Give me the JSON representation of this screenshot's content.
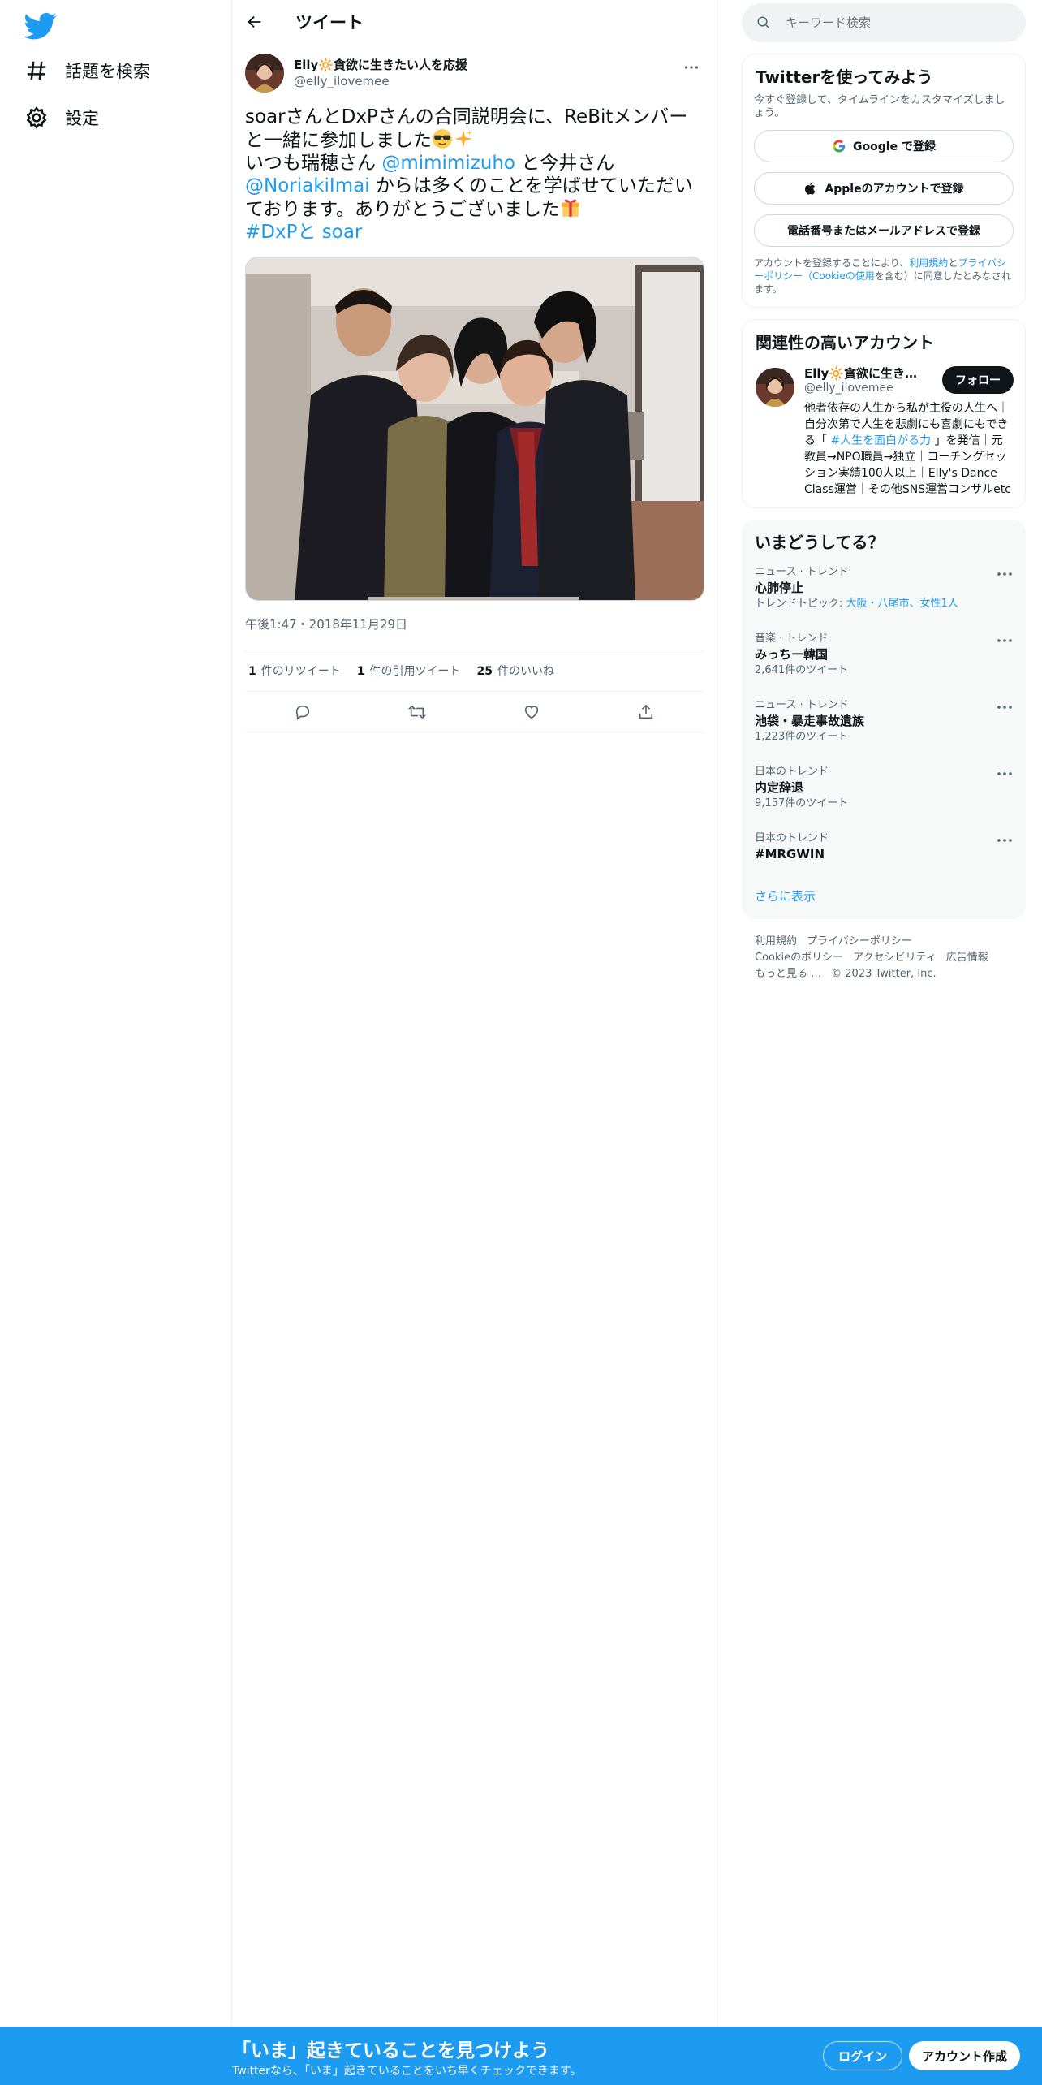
{
  "nav": {
    "items": [
      {
        "label": "話題を検索",
        "icon": "hashtag-icon"
      },
      {
        "label": "設定",
        "icon": "gear-icon"
      }
    ]
  },
  "header": {
    "title": "ツイート"
  },
  "tweet": {
    "author_name": "Elly🔆貪欲に生きたい人を応援",
    "author_handle": "@elly_ilovemee",
    "text": {
      "line1": "soarさんとDxPさんの合同説明会に、ReBitメンバーと一緒に参加しました",
      "line2_pre": "いつも瑞穂さん ",
      "mention1": "@mimimizuho",
      "line2_post": " と今井さん",
      "mention2": "@NoriakiImai",
      "line3_post": " からは多くのことを学ばせていただいております。ありがとうございました",
      "hashtag": "#DxPと soar"
    },
    "timestamp": "午後1:47・2018年11月29日",
    "stats": {
      "retweets_count": "1",
      "retweets_label": "件のリツイート",
      "quotes_count": "1",
      "quotes_label": "件の引用ツイート",
      "likes_count": "25",
      "likes_label": "件のいいね"
    }
  },
  "search": {
    "placeholder": "キーワード検索"
  },
  "signup": {
    "title": "Twitterを使ってみよう",
    "subtitle": "今すぐ登録して、タイムラインをカスタマイズしましょう。",
    "google_label": "Google で登録",
    "apple_label": "Appleのアカウントで登録",
    "phone_label": "電話番号またはメールアドレスで登録",
    "legal_pre": "アカウントを登録することにより、",
    "legal_terms": "利用規約",
    "legal_and": "と",
    "legal_privacy": "プライバシーポリシー（Cookieの使用",
    "legal_post": "を含む）に同意したとみなされます。"
  },
  "related": {
    "title": "関連性の高いアカウント",
    "name": "Elly🔆貪欲に生きた...",
    "handle": "@elly_ilovemee",
    "follow_label": "フォロー",
    "bio_pre": "他者依存の人生から私が主役の人生へ｜自分次第で人生を悲劇にも喜劇にもできる「 ",
    "bio_tag": "#人生を面白がる力",
    "bio_post": " 」を発信｜元教員→NPO職員→独立｜コーチングセッション実績100人以上｜Elly's Dance Class運営｜その他SNS運営コンサルetc"
  },
  "trends": {
    "title": "いまどうしてる？",
    "items": [
      {
        "meta": "ニュース · トレンド",
        "name": "心肺停止",
        "sub_pre": "トレンドトピック: ",
        "sub_link": "大阪・八尾市、女性1人"
      },
      {
        "meta": "音楽 · トレンド",
        "name": "みっちー韓国",
        "sub_pre": "2,641件のツイート",
        "sub_link": ""
      },
      {
        "meta": "ニュース · トレンド",
        "name": "池袋・暴走事故遺族",
        "sub_pre": "1,223件のツイート",
        "sub_link": ""
      },
      {
        "meta": "日本のトレンド",
        "name": "内定辞退",
        "sub_pre": "9,157件のツイート",
        "sub_link": ""
      },
      {
        "meta": "日本のトレンド",
        "name": "#MRGWIN",
        "sub_pre": "",
        "sub_link": ""
      }
    ],
    "show_more": "さらに表示"
  },
  "footer": {
    "terms": "利用規約",
    "privacy": "プライバシーポリシー",
    "cookie": "Cookieのポリシー",
    "accessibility": "アクセシビリティ",
    "ads": "広告情報",
    "more": "もっと見る …",
    "copyright": "© 2023 Twitter, Inc."
  },
  "banner": {
    "title": "「いま」起きていることを見つけよう",
    "subtitle": "Twitterなら、「いま」起きていることをいち早くチェックできます。",
    "login": "ログイン",
    "signup": "アカウント作成"
  },
  "colors": {
    "accent": "#1d9bf0",
    "text": "#0f1419",
    "muted": "#536471"
  }
}
